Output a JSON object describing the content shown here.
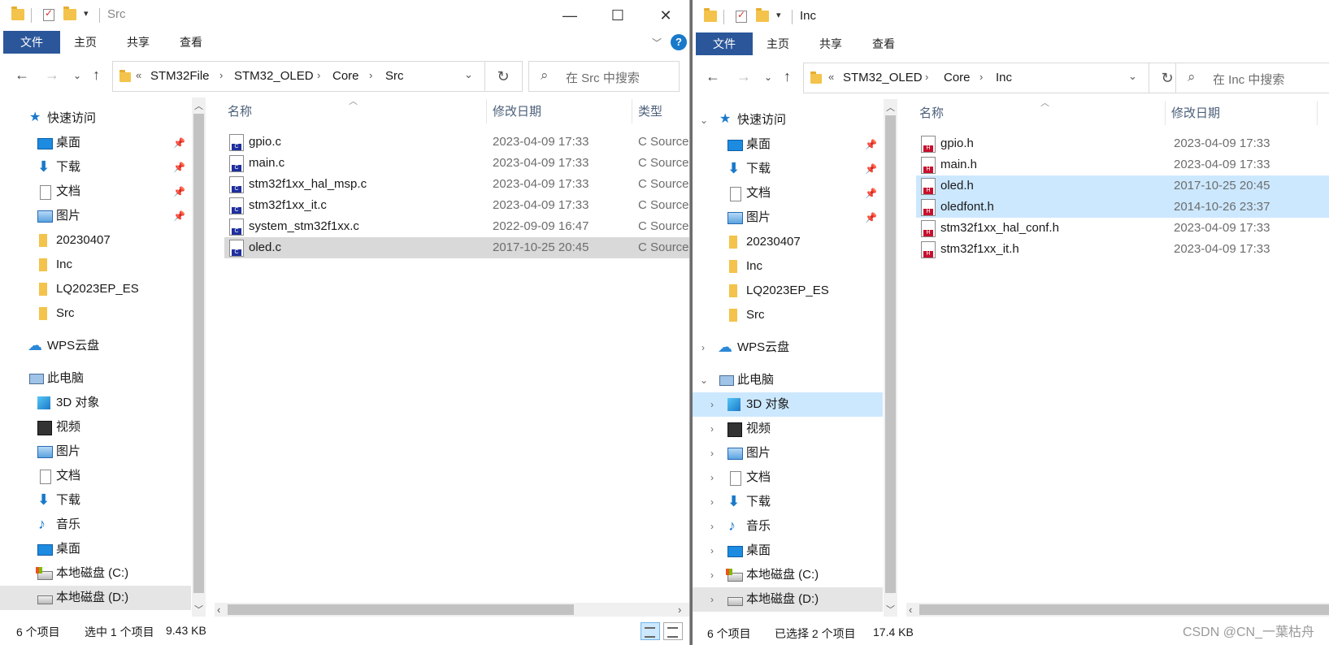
{
  "left": {
    "title": "Src",
    "ribbon_tabs": [
      "文件",
      "主页",
      "共享",
      "查看"
    ],
    "breadcrumb": [
      "STM32File",
      "STM32_OLED",
      "Core",
      "Src"
    ],
    "overflow": "«",
    "search_placeholder": "在 Src 中搜索",
    "columns": {
      "name": "名称",
      "date": "修改日期",
      "type": "类型"
    },
    "files": [
      {
        "name": "gpio.c",
        "date": "2023-04-09 17:33",
        "type": "C Source"
      },
      {
        "name": "main.c",
        "date": "2023-04-09 17:33",
        "type": "C Source"
      },
      {
        "name": "stm32f1xx_hal_msp.c",
        "date": "2023-04-09 17:33",
        "type": "C Source"
      },
      {
        "name": "stm32f1xx_it.c",
        "date": "2023-04-09 17:33",
        "type": "C Source"
      },
      {
        "name": "system_stm32f1xx.c",
        "date": "2022-09-09 16:47",
        "type": "C Source"
      },
      {
        "name": "oled.c",
        "date": "2017-10-25 20:45",
        "type": "C Source"
      }
    ],
    "status": {
      "count": "6 个项目",
      "selection": "选中 1 个项目",
      "size": "9.43 KB"
    }
  },
  "right": {
    "title": "Inc",
    "ribbon_tabs": [
      "文件",
      "主页",
      "共享",
      "查看"
    ],
    "breadcrumb": [
      "STM32_OLED",
      "Core",
      "Inc"
    ],
    "overflow": "«",
    "search_placeholder": "在 Inc 中搜索",
    "columns": {
      "name": "名称",
      "date": "修改日期"
    },
    "files": [
      {
        "name": "gpio.h",
        "date": "2023-04-09 17:33"
      },
      {
        "name": "main.h",
        "date": "2023-04-09 17:33"
      },
      {
        "name": "oled.h",
        "date": "2017-10-25 20:45"
      },
      {
        "name": "oledfont.h",
        "date": "2014-10-26 23:37"
      },
      {
        "name": "stm32f1xx_hal_conf.h",
        "date": "2023-04-09 17:33"
      },
      {
        "name": "stm32f1xx_it.h",
        "date": "2023-04-09 17:33"
      }
    ],
    "status": {
      "count": "6 个项目",
      "selection": "已选择 2 个项目",
      "size": "17.4 KB"
    }
  },
  "nav": {
    "quick_access": "快速访问",
    "desktop": "桌面",
    "downloads": "下载",
    "documents": "文档",
    "pictures": "图片",
    "folder_20230407": "20230407",
    "folder_inc": "Inc",
    "folder_lq": "LQ2023EP_ES",
    "folder_src": "Src",
    "wps": "WPS云盘",
    "this_pc": "此电脑",
    "objects3d": "3D 对象",
    "videos": "视频",
    "music": "音乐",
    "drive_c": "本地磁盘 (C:)",
    "drive_d": "本地磁盘 (D:)"
  },
  "watermark": "CSDN @CN_一葉枯舟"
}
